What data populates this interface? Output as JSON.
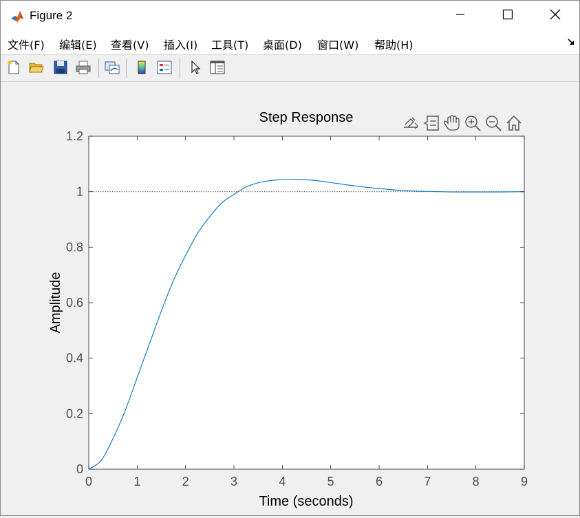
{
  "window": {
    "title": "Figure 2",
    "icon": "matlab-logo-icon"
  },
  "menu": [
    {
      "label": "文件(F)"
    },
    {
      "label": "编辑(E)"
    },
    {
      "label": "查看(V)"
    },
    {
      "label": "插入(I)"
    },
    {
      "label": "工具(T)"
    },
    {
      "label": "桌面(D)"
    },
    {
      "label": "窗口(W)"
    },
    {
      "label": "帮助(H)"
    }
  ],
  "toolbar": {
    "buttons": [
      "new-figure-icon",
      "open-file-icon",
      "save-icon",
      "print-icon",
      "link-plot-icon",
      "colorbar-icon",
      "legend-icon",
      "edit-plot-arrow-icon",
      "property-inspector-icon"
    ]
  },
  "axes_toolbar": [
    "export-icon",
    "data-tips-icon",
    "pan-hand-icon",
    "zoom-in-icon",
    "zoom-out-icon",
    "home-icon"
  ],
  "colors": {
    "line": "#0072bd",
    "axes_text": "#4d4d4d",
    "axes_box": "#262626"
  },
  "chart_data": {
    "type": "line",
    "title": "Step Response",
    "xlabel": "Time (seconds)",
    "ylabel": "Amplitude",
    "xlim": [
      0,
      9
    ],
    "ylim": [
      0,
      1.2
    ],
    "xticks": [
      "0",
      "1",
      "2",
      "3",
      "4",
      "5",
      "6",
      "7",
      "8",
      "9"
    ],
    "yticks": [
      "0",
      "0.2",
      "0.4",
      "0.6",
      "0.8",
      "1",
      "1.2"
    ],
    "grid": false,
    "reference_line": {
      "y": 1,
      "style": "dotted"
    },
    "series": [
      {
        "x": [
          0,
          0.25,
          0.5,
          0.75,
          1.0,
          1.25,
          1.5,
          1.75,
          2.0,
          2.25,
          2.5,
          2.75,
          3.0,
          3.25,
          3.5,
          3.75,
          4.0,
          4.25,
          4.5,
          4.75,
          5.0,
          5.5,
          6.0,
          6.5,
          7.0,
          7.5,
          8.0,
          8.5,
          9.0
        ],
        "y": [
          0,
          0.03,
          0.11,
          0.21,
          0.33,
          0.45,
          0.57,
          0.68,
          0.77,
          0.85,
          0.91,
          0.96,
          0.99,
          1.017,
          1.032,
          1.04,
          1.044,
          1.045,
          1.043,
          1.039,
          1.033,
          1.021,
          1.011,
          1.004,
          1.001,
          0.999,
          0.999,
          0.999,
          1.0
        ]
      }
    ]
  }
}
